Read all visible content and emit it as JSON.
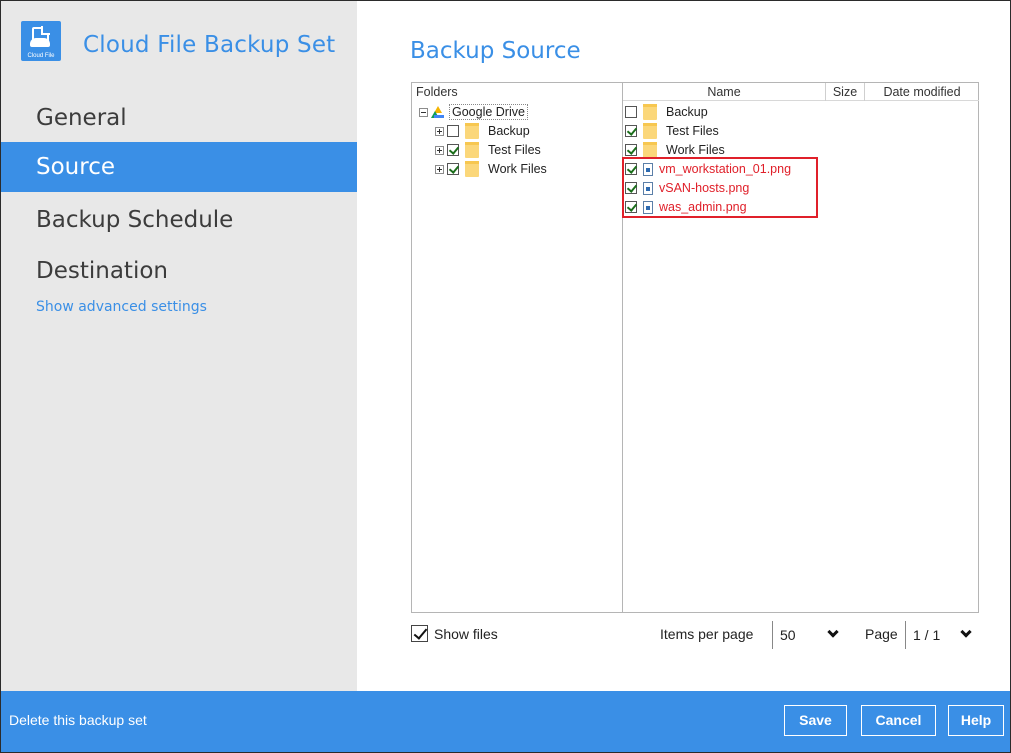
{
  "app": {
    "title": "Cloud File Backup Set",
    "logo_caption": "Cloud File"
  },
  "sidebar": {
    "items": [
      {
        "label": "General",
        "selected": false
      },
      {
        "label": "Source",
        "selected": true
      },
      {
        "label": "Backup Schedule",
        "selected": false
      },
      {
        "label": "Destination",
        "selected": false
      }
    ],
    "advanced_link": "Show advanced settings"
  },
  "main": {
    "title": "Backup Source",
    "folders_header": "Folders",
    "tree": {
      "root": "Google Drive",
      "children": [
        {
          "label": "Backup",
          "checked": false
        },
        {
          "label": "Test Files",
          "checked": true
        },
        {
          "label": "Work Files",
          "checked": true
        }
      ]
    },
    "columns": {
      "name": "Name",
      "size": "Size",
      "date": "Date modified"
    },
    "files": [
      {
        "name": "Backup",
        "type": "folder",
        "checked": false,
        "highlighted": false
      },
      {
        "name": "Test Files",
        "type": "folder",
        "checked": true,
        "highlighted": false
      },
      {
        "name": "Work Files",
        "type": "folder",
        "checked": true,
        "highlighted": false
      },
      {
        "name": "vm_workstation_01.png",
        "type": "file",
        "checked": true,
        "highlighted": true
      },
      {
        "name": "vSAN-hosts.png",
        "type": "file",
        "checked": true,
        "highlighted": true
      },
      {
        "name": "was_admin.png",
        "type": "file",
        "checked": true,
        "highlighted": true
      }
    ],
    "show_files_label": "Show files",
    "show_files_checked": true,
    "items_per_page_label": "Items per page",
    "items_per_page_value": "50",
    "page_label": "Page",
    "page_value": "1 / 1"
  },
  "footer": {
    "delete_link": "Delete this backup set",
    "save": "Save",
    "cancel": "Cancel",
    "help": "Help"
  },
  "colors": {
    "accent": "#3a8fe6",
    "highlight_red": "#e0202a",
    "sidebar_bg": "#e8e8e8"
  },
  "icons": {
    "logo": "cloud-file-icon",
    "root": "google-drive-icon",
    "folder": "folder-icon",
    "file": "image-file-icon",
    "dropdown": "chevron-down-icon"
  }
}
